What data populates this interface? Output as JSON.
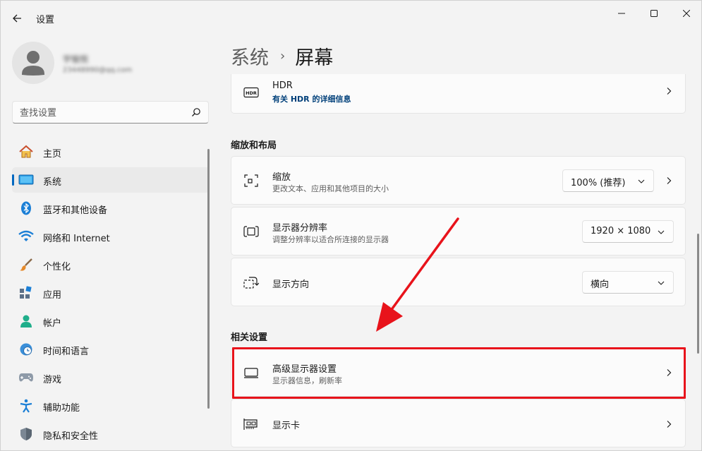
{
  "window": {
    "app_title": "设置",
    "controls": {
      "minimize": "minimize",
      "maximize": "maximize",
      "close": "close"
    }
  },
  "profile": {
    "name": "宇愉悦",
    "email": "23448990@qq.com"
  },
  "search": {
    "placeholder": "查找设置"
  },
  "nav": {
    "items": [
      {
        "label": "主页",
        "icon": "home-icon"
      },
      {
        "label": "系统",
        "icon": "display-icon",
        "active": true
      },
      {
        "label": "蓝牙和其他设备",
        "icon": "bluetooth-icon"
      },
      {
        "label": "网络和 Internet",
        "icon": "wifi-icon"
      },
      {
        "label": "个性化",
        "icon": "brush-icon"
      },
      {
        "label": "应用",
        "icon": "apps-icon"
      },
      {
        "label": "帐户",
        "icon": "person-icon"
      },
      {
        "label": "时间和语言",
        "icon": "clock-globe-icon"
      },
      {
        "label": "游戏",
        "icon": "gamepad-icon"
      },
      {
        "label": "辅助功能",
        "icon": "accessibility-icon"
      },
      {
        "label": "隐私和安全性",
        "icon": "shield-icon"
      }
    ]
  },
  "header": {
    "parent": "系统",
    "separator": "›",
    "current": "屏幕"
  },
  "content": {
    "hdr": {
      "title": "HDR",
      "link": "有关 HDR 的详细信息",
      "icon": "hdr-icon"
    },
    "scale_layout_heading": "缩放和布局",
    "scale": {
      "title": "缩放",
      "subtitle": "更改文本、应用和其他项目的大小",
      "value": "100% (推荐)",
      "icon": "scale-icon"
    },
    "resolution": {
      "title": "显示器分辨率",
      "subtitle": "调整分辨率以适合所连接的显示器",
      "value": "1920 × 1080",
      "icon": "resolution-icon"
    },
    "orientation": {
      "title": "显示方向",
      "value": "横向",
      "icon": "rotate-display-icon"
    },
    "related_heading": "相关设置",
    "advanced": {
      "title": "高级显示器设置",
      "subtitle": "显示器信息，刷新率",
      "icon": "monitor-icon"
    },
    "graphics": {
      "title": "显示卡",
      "icon": "graphics-card-icon"
    }
  },
  "colors": {
    "accent": "#0067c0",
    "highlight_annotation": "#e8131b",
    "background": "#f3f3f3",
    "card": "#fbfbfb"
  }
}
